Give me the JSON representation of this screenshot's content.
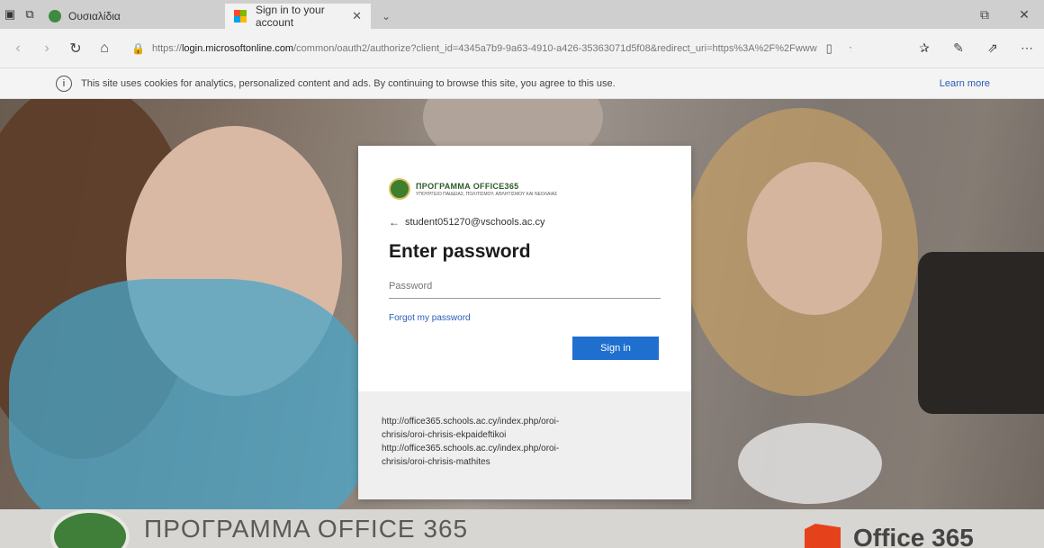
{
  "browser": {
    "tabs": [
      {
        "label": "Ουσιαλίδια",
        "active": false
      },
      {
        "label": "Sign in to your account",
        "active": true
      }
    ],
    "url": {
      "prefix": "https://",
      "host": "login.microsoftonline.com",
      "path": "/common/oauth2/authorize?client_id=4345a7b9-9a63-4910-a426-35363071d5f08&redirect_uri=https%3A%2F%2Fwww"
    }
  },
  "cookie_banner": {
    "text": "This site uses cookies for analytics, personalized content and ads. By continuing to browse this site, you agree to this use.",
    "learn_more": "Learn more"
  },
  "signin": {
    "org_title": "ΠΡΟΓΡΑΜΜΑ OFFICE365",
    "org_subtitle": "ΥΠΟΥΡΓΕΙΟ ΠΑΙΔΕΙΑΣ, ΠΟΛΙΤΙΣΜΟΥ, ΑΘΛΗΤΙΣΜΟΥ ΚΑΙ ΝΕΟΛΑΙΑΣ",
    "identity": "student051270@vschools.ac.cy",
    "title": "Enter password",
    "password_placeholder": "Password",
    "forgot": "Forgot my password",
    "signin_label": "Sign in",
    "footer_lines": [
      "http://office365.schools.ac.cy/index.php/oroi-",
      "chrisis/oroi-chrisis-ekpaideftikoi",
      "http://office365.schools.ac.cy/index.php/oroi-",
      "chrisis/oroi-chrisis-mathites"
    ]
  },
  "background": {
    "banner_title": "ΠΡΟΓΡΑΜΜΑ OFFICE 365",
    "office_word": "Office 365"
  },
  "colors": {
    "accent": "#1f6fcf",
    "link": "#2a5bb8",
    "brand_green": "#3d7e2f"
  }
}
